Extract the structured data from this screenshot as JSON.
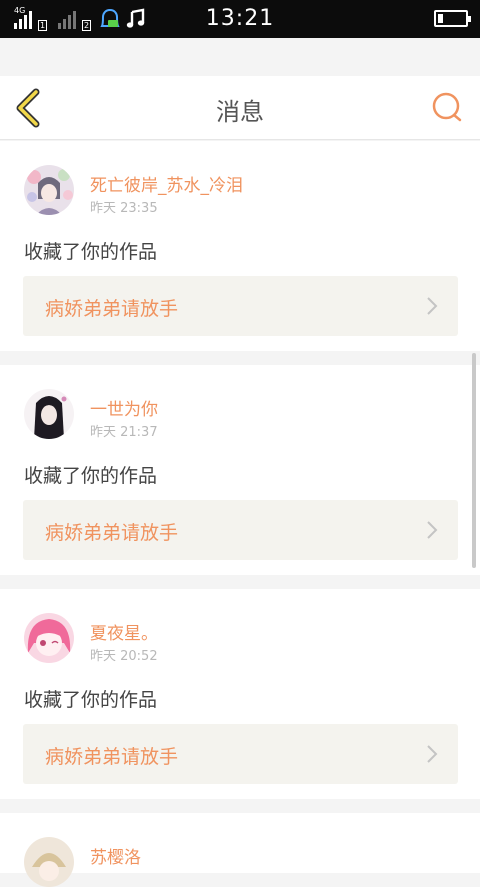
{
  "status_bar": {
    "time": "13:21",
    "network_type": "4G",
    "sim1_label": "1",
    "sim2_label": "2",
    "icons": [
      "signal-icon",
      "signal-icon",
      "chat-notification-icon",
      "music-note-icon",
      "battery-icon"
    ]
  },
  "header": {
    "title": "消息",
    "back_icon": "chevron-left-icon",
    "search_icon": "search-icon"
  },
  "messages": [
    {
      "user": "死亡彼岸_苏水_冷泪",
      "time": "昨天 23:35",
      "action": "收藏了你的作品",
      "work": "病娇弟弟请放手"
    },
    {
      "user": "一世为你",
      "time": "昨天 21:37",
      "action": "收藏了你的作品",
      "work": "病娇弟弟请放手"
    },
    {
      "user": "夏夜星。",
      "time": "昨天 20:52",
      "action": "收藏了你的作品",
      "work": "病娇弟弟请放手"
    },
    {
      "user": "苏樱洛"
    }
  ],
  "colors": {
    "accent": "#f0935f",
    "back_icon": "#e4c13a",
    "work_bg": "#f4f3ee"
  }
}
